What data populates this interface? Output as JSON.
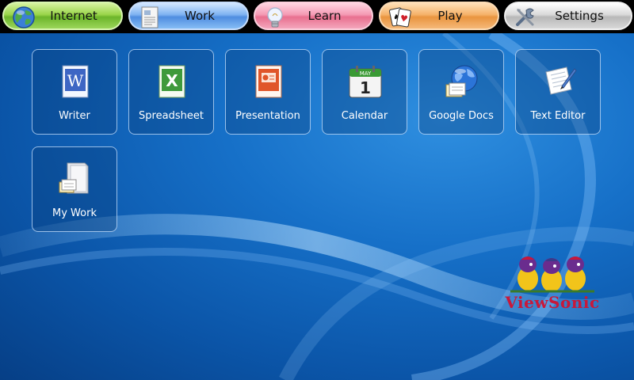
{
  "tabs": [
    {
      "label": "Internet",
      "icon": "globe-icon"
    },
    {
      "label": "Work",
      "icon": "document-icon"
    },
    {
      "label": "Learn",
      "icon": "lightbulb-icon"
    },
    {
      "label": "Play",
      "icon": "playing-cards-icon"
    },
    {
      "label": "Settings",
      "icon": "tools-icon"
    }
  ],
  "apps": [
    {
      "label": "Writer",
      "icon": "writer-icon"
    },
    {
      "label": "Spreadsheet",
      "icon": "spreadsheet-icon"
    },
    {
      "label": "Presentation",
      "icon": "presentation-icon"
    },
    {
      "label": "Calendar",
      "icon": "calendar-icon"
    },
    {
      "label": "Google Docs",
      "icon": "google-docs-icon"
    },
    {
      "label": "Text Editor",
      "icon": "text-editor-icon"
    },
    {
      "label": "My Work",
      "icon": "folder-icon"
    }
  ],
  "calendar_icon": {
    "month": "MAY",
    "day": "1"
  },
  "writer_icon_letter": "W",
  "spreadsheet_icon_letter": "X",
  "brand": {
    "name": "ViewSonic",
    "colors": {
      "red": "#c8183a",
      "purple": "#6a2c8e",
      "yellow": "#f2c41a"
    }
  },
  "colors": {
    "internet": "#9ad54a",
    "work": "#7fb3f2",
    "learn": "#f49ab4",
    "play": "#f5b26a",
    "settings": "#d9d9d9",
    "desktop": "#1670c8"
  }
}
